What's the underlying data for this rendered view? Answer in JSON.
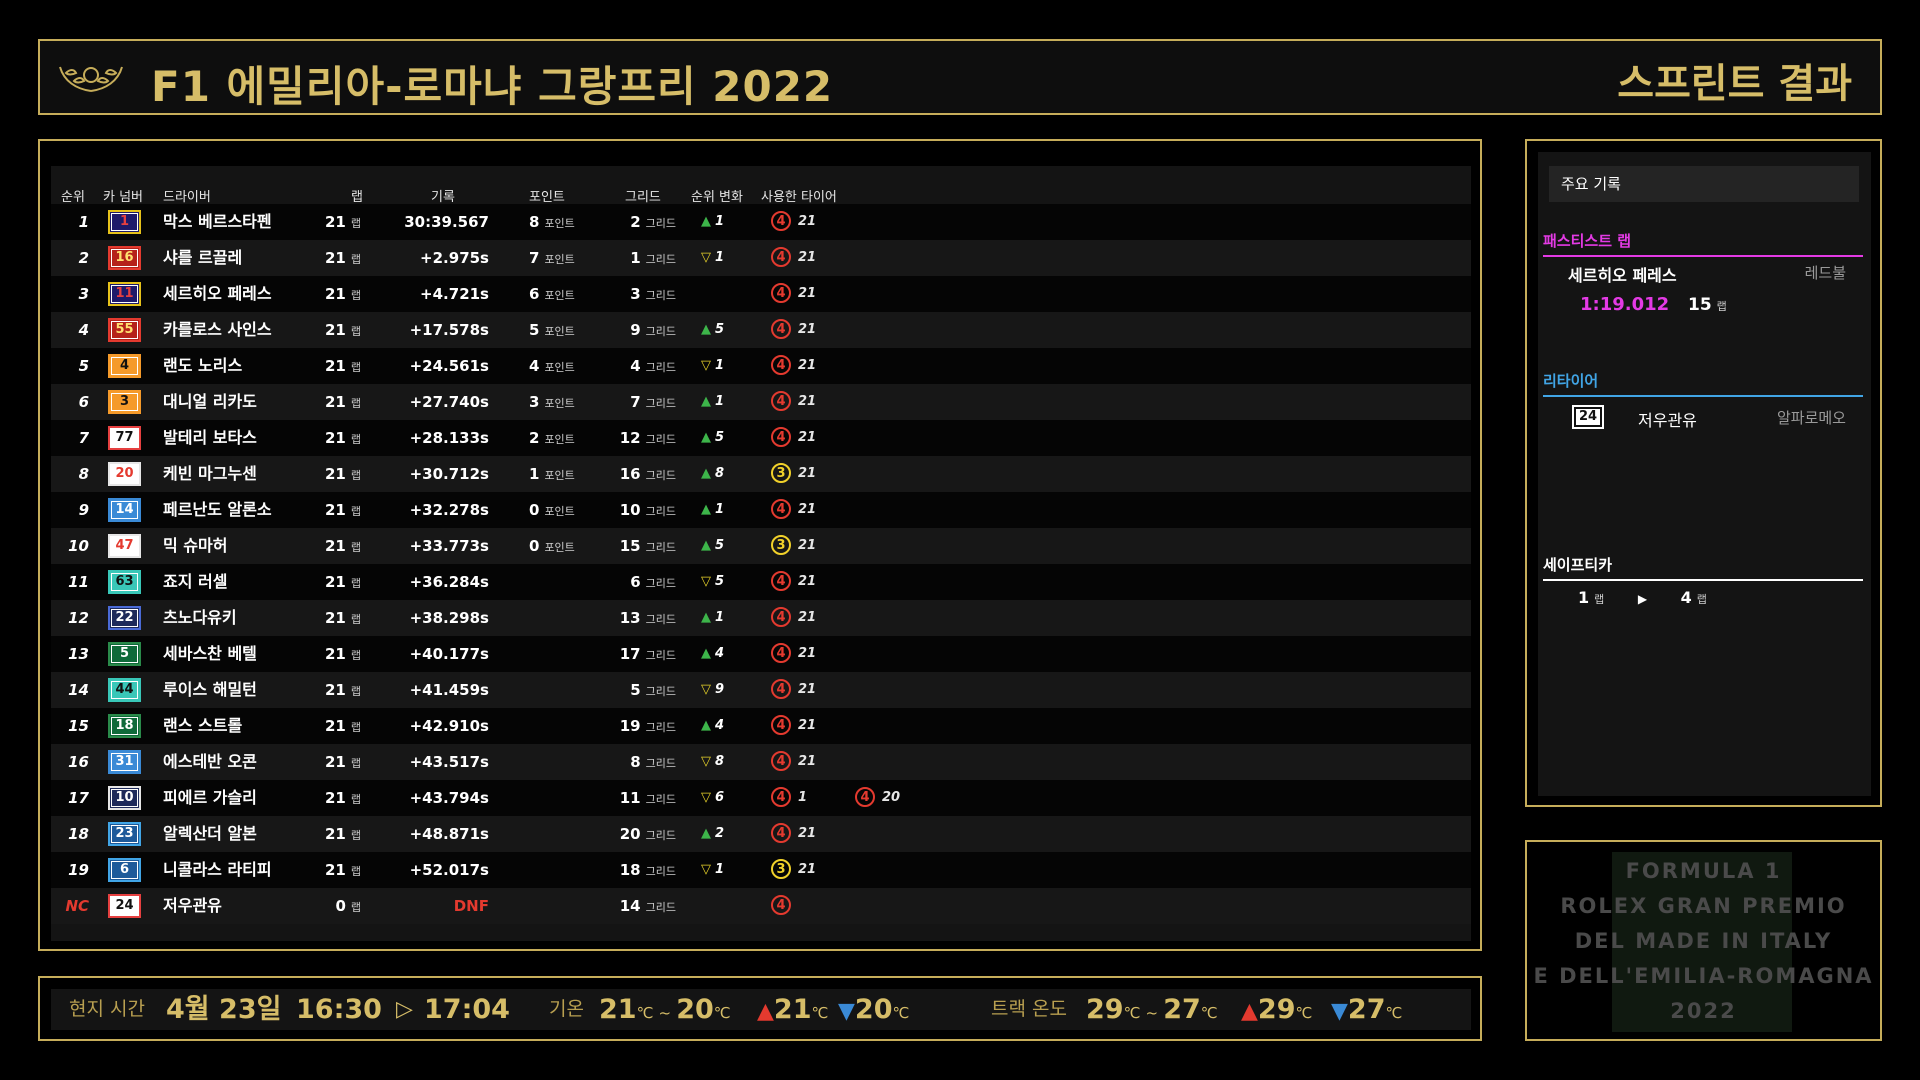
{
  "header": {
    "race_title": "F1 에밀리아-로마냐 그랑프리 2022",
    "session_title": "스프린트 결과"
  },
  "columns": {
    "pos": "순위",
    "car": "카 넘버",
    "driver": "드라이버",
    "laps": "랩",
    "time": "기록",
    "points": "포인트",
    "grid": "그리드",
    "change": "순위 변화",
    "tyres": "사용한 타이어"
  },
  "units": {
    "lap": "랩",
    "points": "포인트",
    "grid": "그리드"
  },
  "results": [
    {
      "pos": "1",
      "car": "1",
      "car_color": "#e6c21a",
      "car_bg": "#1e1a6a",
      "car_text": "#e64040",
      "driver": "막스 베르스타펜",
      "laps": "21",
      "time": "30:39.567",
      "points": "8",
      "grid": "2",
      "dir": "up",
      "change": "1",
      "tyres": [
        {
          "c": "soft",
          "g": "4",
          "l": "21"
        }
      ]
    },
    {
      "pos": "2",
      "car": "16",
      "car_color": "#e43a2f",
      "car_bg": "#b5221a",
      "car_text": "#ffe070",
      "driver": "샤를 르끌레",
      "laps": "21",
      "time": "+2.975s",
      "points": "7",
      "grid": "1",
      "dir": "down",
      "change": "1",
      "tyres": [
        {
          "c": "soft",
          "g": "4",
          "l": "21"
        }
      ]
    },
    {
      "pos": "3",
      "car": "11",
      "car_color": "#e6c21a",
      "car_bg": "#1e1a6a",
      "car_text": "#e64040",
      "driver": "세르히오 페레스",
      "laps": "21",
      "time": "+4.721s",
      "points": "6",
      "grid": "3",
      "dir": "",
      "change": "",
      "tyres": [
        {
          "c": "soft",
          "g": "4",
          "l": "21"
        }
      ]
    },
    {
      "pos": "4",
      "car": "55",
      "car_color": "#e43a2f",
      "car_bg": "#b5221a",
      "car_text": "#ffe070",
      "driver": "카를로스 사인스",
      "laps": "21",
      "time": "+17.578s",
      "points": "5",
      "grid": "9",
      "dir": "up",
      "change": "5",
      "tyres": [
        {
          "c": "soft",
          "g": "4",
          "l": "21"
        }
      ]
    },
    {
      "pos": "5",
      "car": "4",
      "car_color": "#f59a2a",
      "car_bg": "#f59a2a",
      "car_text": "#111",
      "driver": "랜도 노리스",
      "laps": "21",
      "time": "+24.561s",
      "points": "4",
      "grid": "4",
      "dir": "down",
      "change": "1",
      "tyres": [
        {
          "c": "soft",
          "g": "4",
          "l": "21"
        }
      ]
    },
    {
      "pos": "6",
      "car": "3",
      "car_color": "#f59a2a",
      "car_bg": "#f59a2a",
      "car_text": "#111",
      "driver": "대니얼 리카도",
      "laps": "21",
      "time": "+27.740s",
      "points": "3",
      "grid": "7",
      "dir": "up",
      "change": "1",
      "tyres": [
        {
          "c": "soft",
          "g": "4",
          "l": "21"
        }
      ]
    },
    {
      "pos": "7",
      "car": "77",
      "car_color": "#e64040",
      "car_bg": "#fff",
      "car_text": "#111",
      "driver": "발테리 보타스",
      "laps": "21",
      "time": "+28.133s",
      "points": "2",
      "grid": "12",
      "dir": "up",
      "change": "5",
      "tyres": [
        {
          "c": "soft",
          "g": "4",
          "l": "21"
        }
      ]
    },
    {
      "pos": "8",
      "car": "20",
      "car_color": "#e6e6e6",
      "car_bg": "#fff",
      "car_text": "#e43a2f",
      "driver": "케빈 마그누센",
      "laps": "21",
      "time": "+30.712s",
      "points": "1",
      "grid": "16",
      "dir": "up",
      "change": "8",
      "tyres": [
        {
          "c": "medium",
          "g": "3",
          "l": "21"
        }
      ]
    },
    {
      "pos": "9",
      "car": "14",
      "car_color": "#3a8ad6",
      "car_bg": "#3a8ad6",
      "car_text": "#fff",
      "driver": "페르난도 알론소",
      "laps": "21",
      "time": "+32.278s",
      "points": "0",
      "grid": "10",
      "dir": "up",
      "change": "1",
      "tyres": [
        {
          "c": "soft",
          "g": "4",
          "l": "21"
        }
      ]
    },
    {
      "pos": "10",
      "car": "47",
      "car_color": "#e6e6e6",
      "car_bg": "#fff",
      "car_text": "#e43a2f",
      "driver": "믹 슈마허",
      "laps": "21",
      "time": "+33.773s",
      "points": "0",
      "grid": "15",
      "dir": "up",
      "change": "5",
      "tyres": [
        {
          "c": "medium",
          "g": "3",
          "l": "21"
        }
      ]
    },
    {
      "pos": "11",
      "car": "63",
      "car_color": "#39c7b8",
      "car_bg": "#39c7b8",
      "car_text": "#111",
      "driver": "죠지 러셀",
      "laps": "21",
      "time": "+36.284s",
      "points": "",
      "grid": "6",
      "dir": "down",
      "change": "5",
      "tyres": [
        {
          "c": "soft",
          "g": "4",
          "l": "21"
        }
      ]
    },
    {
      "pos": "12",
      "car": "22",
      "car_color": "#4a6ad6",
      "car_bg": "#1e2a5a",
      "car_text": "#fff",
      "driver": "츠노다유키",
      "laps": "21",
      "time": "+38.298s",
      "points": "",
      "grid": "13",
      "dir": "up",
      "change": "1",
      "tyres": [
        {
          "c": "soft",
          "g": "4",
          "l": "21"
        }
      ]
    },
    {
      "pos": "13",
      "car": "5",
      "car_color": "#2a8a4a",
      "car_bg": "#0f6a3a",
      "car_text": "#fff",
      "driver": "세바스찬 베텔",
      "laps": "21",
      "time": "+40.177s",
      "points": "",
      "grid": "17",
      "dir": "up",
      "change": "4",
      "tyres": [
        {
          "c": "soft",
          "g": "4",
          "l": "21"
        }
      ]
    },
    {
      "pos": "14",
      "car": "44",
      "car_color": "#39c7b8",
      "car_bg": "#39c7b8",
      "car_text": "#111",
      "driver": "루이스 해밀턴",
      "laps": "21",
      "time": "+41.459s",
      "points": "",
      "grid": "5",
      "dir": "down",
      "change": "9",
      "tyres": [
        {
          "c": "soft",
          "g": "4",
          "l": "21"
        }
      ]
    },
    {
      "pos": "15",
      "car": "18",
      "car_color": "#2a8a4a",
      "car_bg": "#0f6a3a",
      "car_text": "#fff",
      "driver": "랜스 스트롤",
      "laps": "21",
      "time": "+42.910s",
      "points": "",
      "grid": "19",
      "dir": "up",
      "change": "4",
      "tyres": [
        {
          "c": "soft",
          "g": "4",
          "l": "21"
        }
      ]
    },
    {
      "pos": "16",
      "car": "31",
      "car_color": "#3a8ad6",
      "car_bg": "#3a8ad6",
      "car_text": "#fff",
      "driver": "에스테반 오콘",
      "laps": "21",
      "time": "+43.517s",
      "points": "",
      "grid": "8",
      "dir": "down",
      "change": "8",
      "tyres": [
        {
          "c": "soft",
          "g": "4",
          "l": "21"
        }
      ]
    },
    {
      "pos": "17",
      "car": "10",
      "car_color": "#e6e6e6",
      "car_bg": "#1e2a5a",
      "car_text": "#fff",
      "driver": "피에르 가슬리",
      "laps": "21",
      "time": "+43.794s",
      "points": "",
      "grid": "11",
      "dir": "down",
      "change": "6",
      "tyres": [
        {
          "c": "soft",
          "g": "4",
          "l": "1"
        },
        {
          "c": "soft",
          "g": "4",
          "l": "20"
        }
      ]
    },
    {
      "pos": "18",
      "car": "23",
      "car_color": "#41a5e6",
      "car_bg": "#1e5a9a",
      "car_text": "#fff",
      "driver": "알렉산더 알본",
      "laps": "21",
      "time": "+48.871s",
      "points": "",
      "grid": "20",
      "dir": "up",
      "change": "2",
      "tyres": [
        {
          "c": "soft",
          "g": "4",
          "l": "21"
        }
      ]
    },
    {
      "pos": "19",
      "car": "6",
      "car_color": "#41a5e6",
      "car_bg": "#1e5a9a",
      "car_text": "#fff",
      "driver": "니콜라스 라티피",
      "laps": "21",
      "time": "+52.017s",
      "points": "",
      "grid": "18",
      "dir": "down",
      "change": "1",
      "tyres": [
        {
          "c": "medium",
          "g": "3",
          "l": "21"
        }
      ]
    },
    {
      "pos": "NC",
      "car": "24",
      "car_color": "#e64040",
      "car_bg": "#fff",
      "car_text": "#111",
      "driver": "저우관유",
      "laps": "0",
      "time": "DNF",
      "points": "",
      "grid": "14",
      "dir": "",
      "change": "",
      "tyres": [
        {
          "c": "soft",
          "g": "4",
          "l": ""
        }
      ]
    }
  ],
  "key_records": {
    "title": "주요 기록",
    "fastest_lap": {
      "title": "패스티스트 랩",
      "driver": "세르히오 페레스",
      "team": "레드불",
      "time": "1:19.012",
      "lap": "15",
      "lap_unit": "랩"
    },
    "retired": {
      "title": "리타이어",
      "car": "24",
      "driver": "저우관유",
      "team": "알파로메오"
    },
    "safety_car": {
      "title": "세이프티카",
      "from": "1",
      "to": "4",
      "unit": "랩",
      "arrow": "▶"
    }
  },
  "footer": {
    "local_time_label": "현지 시간",
    "date": "4월 23일",
    "start": "16:30",
    "arrow": "▷",
    "end": "17:04",
    "air_label": "기온",
    "air_start": "21",
    "air_end": "20",
    "air_max": "21",
    "air_min": "20",
    "track_label": "트랙 온도",
    "track_start": "29",
    "track_end": "27",
    "track_max": "29",
    "track_min": "27",
    "deg": "℃",
    "tilde": "~"
  },
  "event": {
    "lines": [
      "FORMULA 1",
      "ROLEX GRAN PREMIO",
      "DEL MADE IN ITALY",
      "E DELL'EMILIA-ROMAGNA",
      "2022"
    ]
  },
  "colors": {
    "gold": "#c6ad5a",
    "soft": "#e43a2f",
    "medium": "#f1d12a",
    "fastest": "#e43ae5",
    "retire": "#41a5e6"
  }
}
